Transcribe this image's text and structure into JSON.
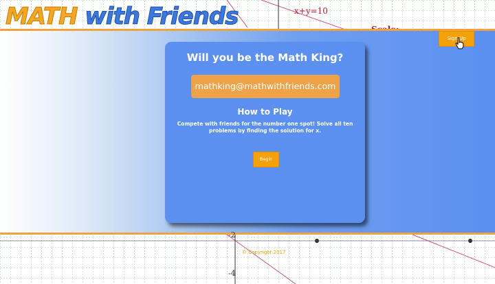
{
  "header": {
    "brand_part1": "MATH",
    "brand_part2": "with Friends",
    "sign_up_label": "Sign Up"
  },
  "graph": {
    "equation": "x+y=10",
    "scale_label": "Scale:",
    "tick_neg2": "-2",
    "tick_neg4": "-4"
  },
  "card": {
    "title": "Will you be the Math King?",
    "email_value": "mathking@mathwithfriends.com",
    "how_to_title": "How to Play",
    "description": "Compete with friends for the number one spot! Solve all ten problems by finding the solution for x.",
    "begin_label": "Begin"
  },
  "footer": {
    "copyright": "© Copyright 2017"
  },
  "colors": {
    "brand_orange": "#f5a623",
    "brand_blue": "#3b78e0",
    "card_blue": "#5b8ff0",
    "button_orange": "#f5a20a"
  }
}
